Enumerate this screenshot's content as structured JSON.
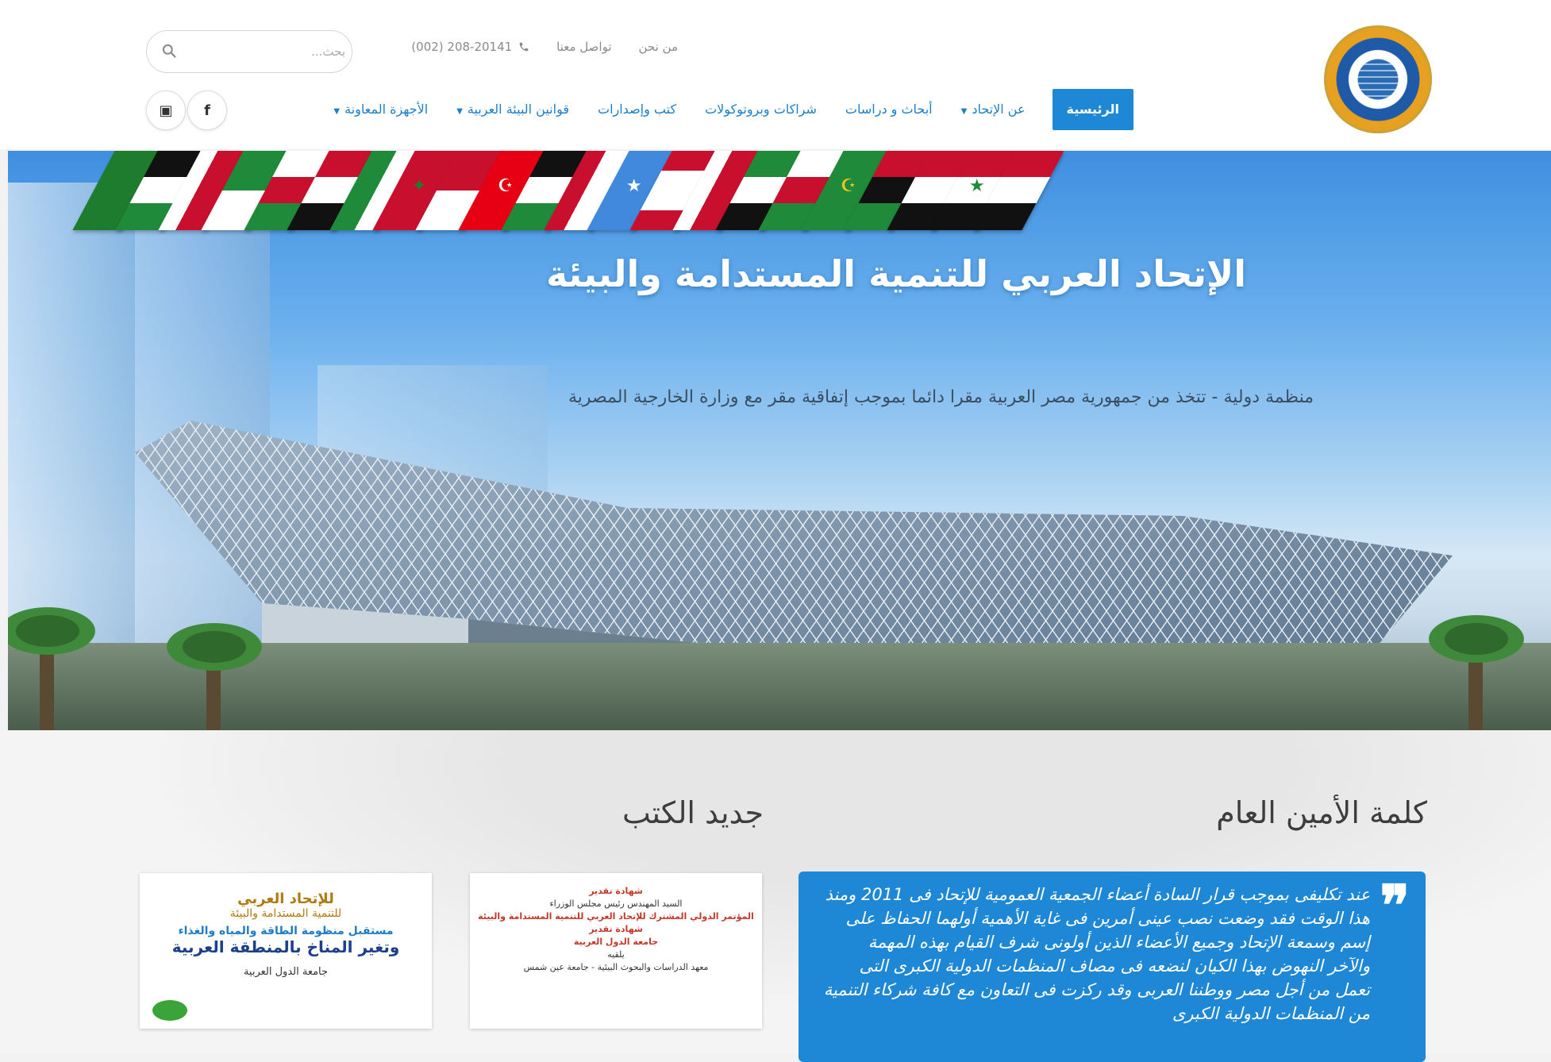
{
  "topbar": {
    "about_link": "من نحن",
    "contact_link": "تواصل معنا",
    "phone": "(002) 208-20141"
  },
  "search": {
    "placeholder": "بحث..."
  },
  "nav": {
    "items": [
      {
        "label": "الرئيسية",
        "active": true,
        "dropdown": false
      },
      {
        "label": "عن الإتحاد",
        "active": false,
        "dropdown": true
      },
      {
        "label": "أبحاث و دراسات",
        "active": false,
        "dropdown": false
      },
      {
        "label": "شراكات وبروتوكولات",
        "active": false,
        "dropdown": false
      },
      {
        "label": "كتب وإصدارات",
        "active": false,
        "dropdown": false
      },
      {
        "label": "قوانين البيئة العربية",
        "active": false,
        "dropdown": true
      },
      {
        "label": "الأجهزة المعاونة",
        "active": false,
        "dropdown": true
      }
    ]
  },
  "social": {
    "facebook": "f",
    "youtube": "▣"
  },
  "hero": {
    "title": "الإتحاد العربي للتنمية المستدامة والبيئة",
    "subtitle": "منظمة دولية - تتخذ من جمهورية مصر العربية مقرا دائما بموجب إتفاقية مقر مع وزارة الخارجية المصرية"
  },
  "sections": {
    "secretary_heading": "كلمة الأمين العام",
    "books_heading": "جديد الكتب"
  },
  "quote": {
    "mark": "❞",
    "text": "عند تكليفى بموجب قرار السادة أعضاء الجمعية العمومية للإتحاد فى 2011 ومنذ هذا الوقت فقد وضعت نصب عينى أمرين فى غاية الأهمية أولهما الحفاظ على إسم وسمعة الإتحاد وجميع الأعضاء الذين أولونى شرف القيام بهذه المهمة والآخر النهوض بهذا الكيان لنضعه فى مصاف المنظمات الدولية الكبرى التى تعمل من أجل مصر ووطننا العربى وقد ركزت فى التعاون مع كافة شركاء التنمية من المنظمات الدولية الكبرى"
  },
  "books": {
    "certificate": {
      "lines": [
        "شهادة تقدير",
        "السيد المهندس رئيس مجلس الوزراء",
        "المؤتمر الدولي المشترك للإتحاد العربي للتنمية المستدامة والبيئة",
        "شهادة تقدير",
        "جامعة الدول العربية",
        "يلقيه",
        "معهد الدراسات والبحوث البيئية - جامعة عين شمس"
      ]
    },
    "cover": {
      "line1": "للإتحاد العربي",
      "line2": "للتنمية المستدامة والبيئة",
      "line3": "مستقبل منظومة الطاقة والمياه والغذاء",
      "line4": "وتغير المناخ بالمنطقة العربية",
      "line5": "جامعة الدول العربية"
    }
  },
  "colors": {
    "accent": "#1f88d6",
    "nav_text": "#1d7fc7"
  }
}
